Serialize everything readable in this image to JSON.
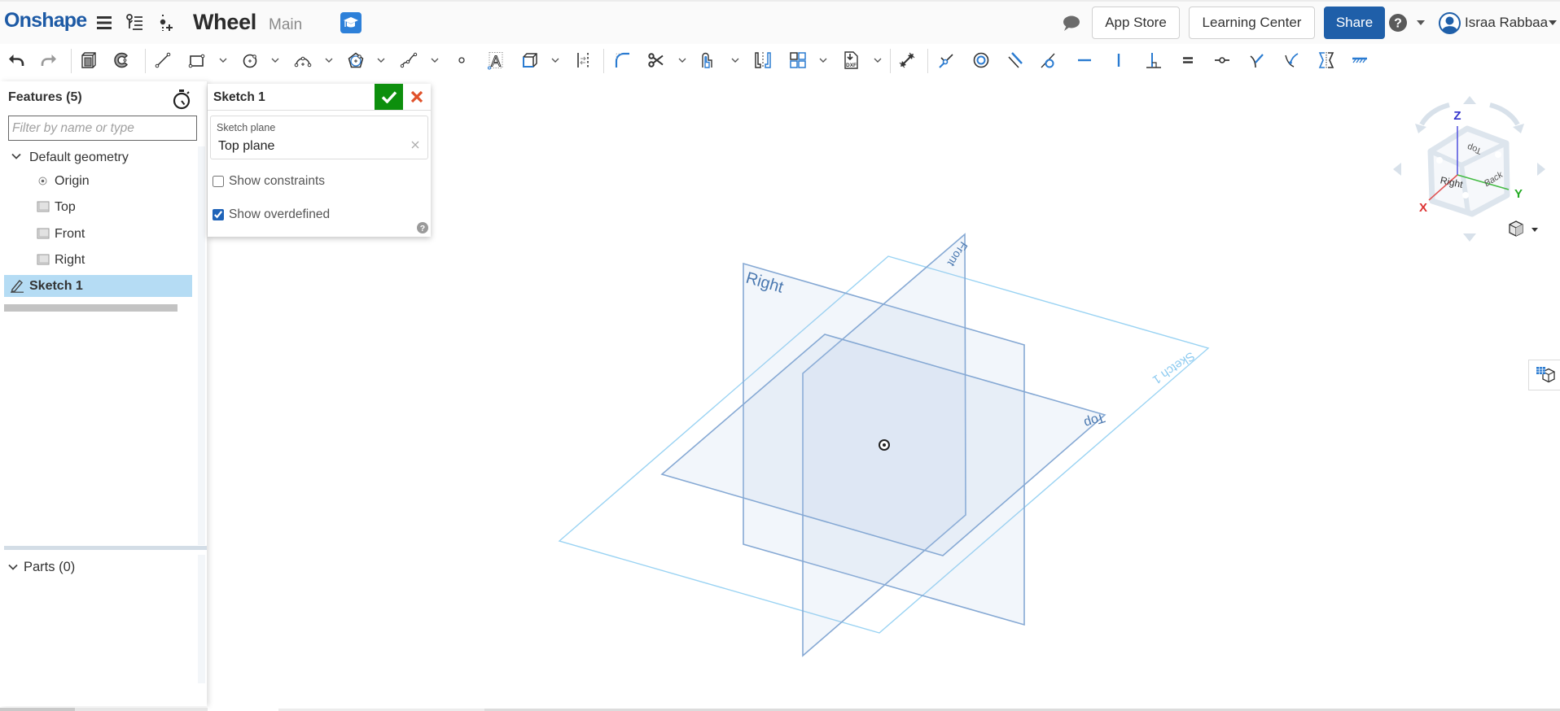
{
  "app": {
    "logo": "Onshape",
    "document_title": "Wheel",
    "workspace": "Main"
  },
  "header": {
    "app_store_label": "App Store",
    "learning_center_label": "Learning Center",
    "share_label": "Share",
    "user_name": "Israa Rabbaa",
    "icons": [
      "menu-icon",
      "feature-list-icon",
      "insert-icon",
      "learning-icon",
      "comments-icon",
      "help-icon",
      "user-avatar-icon"
    ]
  },
  "toolbar": {
    "items": [
      {
        "icon": "undo-icon",
        "dropdown": false
      },
      {
        "icon": "redo-icon",
        "dropdown": false
      },
      {
        "icon": "extrude-icon",
        "dropdown": false
      },
      {
        "icon": "revolve-icon",
        "dropdown": false
      },
      {
        "icon": "line-icon",
        "dropdown": false
      },
      {
        "icon": "rectangle-icon",
        "dropdown": true
      },
      {
        "icon": "circle-icon",
        "dropdown": true
      },
      {
        "icon": "arc-icon",
        "dropdown": true
      },
      {
        "icon": "polygon-icon",
        "dropdown": true
      },
      {
        "icon": "spline-icon",
        "dropdown": true
      },
      {
        "icon": "point-icon",
        "dropdown": false
      },
      {
        "icon": "text-icon",
        "dropdown": false
      },
      {
        "icon": "use-icon",
        "dropdown": true
      },
      {
        "icon": "construction-icon",
        "dropdown": false
      },
      {
        "icon": "fillet-icon",
        "dropdown": false
      },
      {
        "icon": "trim-icon",
        "dropdown": true
      },
      {
        "icon": "offset-icon",
        "dropdown": true
      },
      {
        "icon": "mirror-icon",
        "dropdown": false
      },
      {
        "icon": "linear-pattern-icon",
        "dropdown": true
      },
      {
        "icon": "import-dxf-icon",
        "dropdown": true
      },
      {
        "icon": "dimension-icon",
        "dropdown": false
      },
      {
        "icon": "coincident-icon",
        "dropdown": false
      },
      {
        "icon": "concentric-icon",
        "dropdown": false
      },
      {
        "icon": "parallel-icon",
        "dropdown": false
      },
      {
        "icon": "tangent-icon",
        "dropdown": false
      },
      {
        "icon": "horizontal-icon",
        "dropdown": false
      },
      {
        "icon": "vertical-icon",
        "dropdown": false
      },
      {
        "icon": "perpendicular-icon",
        "dropdown": false
      },
      {
        "icon": "equal-icon",
        "dropdown": false
      },
      {
        "icon": "midpoint-icon",
        "dropdown": false
      },
      {
        "icon": "normal-icon",
        "dropdown": false
      },
      {
        "icon": "pierce-icon",
        "dropdown": false
      },
      {
        "icon": "symmetric-icon",
        "dropdown": false
      },
      {
        "icon": "fix-icon",
        "dropdown": false
      }
    ]
  },
  "features_panel": {
    "title": "Features (5)",
    "filter_placeholder": "Filter by name or type",
    "filter_value": "",
    "default_geometry": {
      "label": "Default geometry",
      "expanded": true,
      "items": [
        {
          "label": "Origin",
          "icon": "origin-icon"
        },
        {
          "label": "Top",
          "icon": "plane-icon"
        },
        {
          "label": "Front",
          "icon": "plane-icon"
        },
        {
          "label": "Right",
          "icon": "plane-icon"
        }
      ]
    },
    "features": [
      {
        "label": "Sketch 1",
        "icon": "sketch-icon",
        "selected": true
      }
    ],
    "parts_label": "Parts (0)"
  },
  "sketch_dialog": {
    "title": "Sketch 1",
    "sketch_plane_label": "Sketch plane",
    "sketch_plane_value": "Top plane",
    "show_constraints_label": "Show constraints",
    "show_constraints_checked": false,
    "show_overdefined_label": "Show overdefined",
    "show_overdefined_checked": true
  },
  "viewport": {
    "plane_labels": {
      "right": "Right",
      "front": "Front",
      "top": "Top",
      "sketch": "Sketch 1"
    },
    "view_cube": {
      "axes": {
        "x": "X",
        "y": "Y",
        "z": "Z"
      },
      "faces": {
        "top": "Top",
        "right": "Right",
        "back": "Back"
      }
    }
  },
  "colors": {
    "brand": "#1d5aa5",
    "share_button": "#1f5fa9",
    "confirm": "#0d8f0d",
    "cancel": "#e0512a",
    "selection": "#b5dcf4",
    "plane_stroke": "#86a9d4",
    "sketch_plane_stroke": "#9ad3f3",
    "axis_x": "#dd3333",
    "axis_y": "#22aa22",
    "axis_z": "#3333cc"
  }
}
